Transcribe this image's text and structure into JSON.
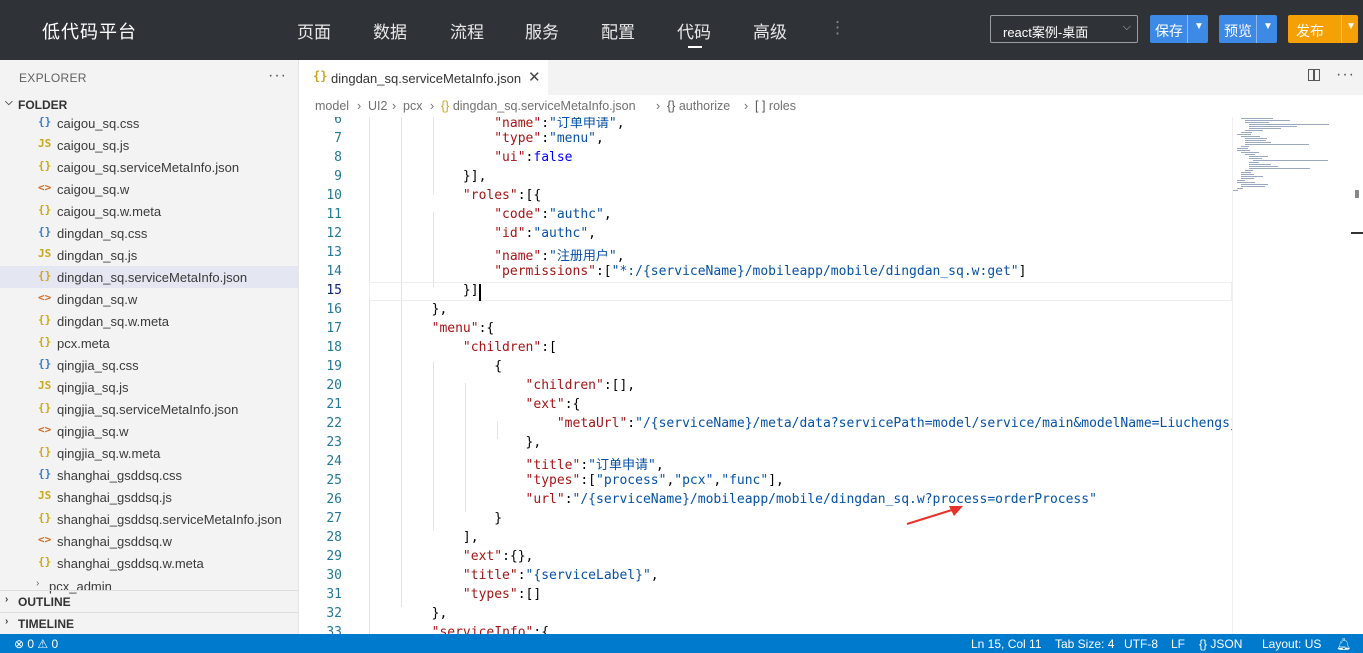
{
  "app": {
    "title": "低代码平台"
  },
  "nav": {
    "items": [
      "页面",
      "数据",
      "流程",
      "服务",
      "配置",
      "代码",
      "高级"
    ],
    "active": "代码"
  },
  "toolbar": {
    "project_select": "react案例-桌面",
    "save_label": "保存",
    "preview_label": "预览",
    "publish_label": "发布",
    "save_color": "#3d8ae6",
    "publish_color": "#f5a105"
  },
  "sidebar": {
    "explorer_title": "EXPLORER",
    "folder_title": "FOLDER",
    "files": [
      {
        "name": "caigou_sq.css",
        "type": "css",
        "icon": "{}"
      },
      {
        "name": "caigou_sq.js",
        "type": "js",
        "icon": "JS"
      },
      {
        "name": "caigou_sq.serviceMetaInfo.json",
        "type": "json",
        "icon": "{}"
      },
      {
        "name": "caigou_sq.w",
        "type": "w",
        "icon": "<>"
      },
      {
        "name": "caigou_sq.w.meta",
        "type": "json",
        "icon": "{}"
      },
      {
        "name": "dingdan_sq.css",
        "type": "css",
        "icon": "{}"
      },
      {
        "name": "dingdan_sq.js",
        "type": "js",
        "icon": "JS"
      },
      {
        "name": "dingdan_sq.serviceMetaInfo.json",
        "type": "json",
        "icon": "{}",
        "selected": true
      },
      {
        "name": "dingdan_sq.w",
        "type": "w",
        "icon": "<>"
      },
      {
        "name": "dingdan_sq.w.meta",
        "type": "json",
        "icon": "{}"
      },
      {
        "name": "pcx.meta",
        "type": "json",
        "icon": "{}"
      },
      {
        "name": "qingjia_sq.css",
        "type": "css",
        "icon": "{}"
      },
      {
        "name": "qingjia_sq.js",
        "type": "js",
        "icon": "JS"
      },
      {
        "name": "qingjia_sq.serviceMetaInfo.json",
        "type": "json",
        "icon": "{}"
      },
      {
        "name": "qingjia_sq.w",
        "type": "w",
        "icon": "<>"
      },
      {
        "name": "qingjia_sq.w.meta",
        "type": "json",
        "icon": "{}"
      },
      {
        "name": "shanghai_gsddsq.css",
        "type": "css",
        "icon": "{}"
      },
      {
        "name": "shanghai_gsddsq.js",
        "type": "js",
        "icon": "JS"
      },
      {
        "name": "shanghai_gsddsq.serviceMetaInfo.json",
        "type": "json",
        "icon": "{}"
      },
      {
        "name": "shanghai_gsddsq.w",
        "type": "w",
        "icon": "<>"
      },
      {
        "name": "shanghai_gsddsq.w.meta",
        "type": "json",
        "icon": "{}"
      }
    ],
    "subfolder": "pcx_admin",
    "outline_title": "OUTLINE",
    "timeline_title": "TIMELINE"
  },
  "editor": {
    "tab_label": "dingdan_sq.serviceMetaInfo.json",
    "breadcrumb": [
      "model",
      "UI2",
      "pcx",
      "dingdan_sq.serviceMetaInfo.json",
      "authorize",
      "roles"
    ],
    "current_line": 15,
    "lines": [
      {
        "n": 6,
        "text": "                \"name\":\"订单申请\","
      },
      {
        "n": 7,
        "text": "                \"type\":\"menu\","
      },
      {
        "n": 8,
        "text": "                \"ui\":false"
      },
      {
        "n": 9,
        "text": "            }],"
      },
      {
        "n": 10,
        "text": "            \"roles\":[{"
      },
      {
        "n": 11,
        "text": "                \"code\":\"authc\","
      },
      {
        "n": 12,
        "text": "                \"id\":\"authc\","
      },
      {
        "n": 13,
        "text": "                \"name\":\"注册用户\","
      },
      {
        "n": 14,
        "text": "                \"permissions\":[\"*:/{serviceName}/mobileapp/mobile/dingdan_sq.w:get\"]"
      },
      {
        "n": 15,
        "text": "            }]"
      },
      {
        "n": 16,
        "text": "        },"
      },
      {
        "n": 17,
        "text": "        \"menu\":{"
      },
      {
        "n": 18,
        "text": "            \"children\":["
      },
      {
        "n": 19,
        "text": "                {"
      },
      {
        "n": 20,
        "text": "                    \"children\":[],"
      },
      {
        "n": 21,
        "text": "                    \"ext\":{"
      },
      {
        "n": 22,
        "text": "                        \"metaUrl\":\"/{serviceName}/meta/data?servicePath=model/service/main&modelName=Liuchengsj\""
      },
      {
        "n": 23,
        "text": "                    },"
      },
      {
        "n": 24,
        "text": "                    \"title\":\"订单申请\","
      },
      {
        "n": 25,
        "text": "                    \"types\":[\"process\",\"pcx\",\"func\"],"
      },
      {
        "n": 26,
        "text": "                    \"url\":\"/{serviceName}/mobileapp/mobile/dingdan_sq.w?process=orderProcess\""
      },
      {
        "n": 27,
        "text": "                }"
      },
      {
        "n": 28,
        "text": "            ],"
      },
      {
        "n": 29,
        "text": "            \"ext\":{},"
      },
      {
        "n": 30,
        "text": "            \"title\":\"{serviceLabel}\","
      },
      {
        "n": 31,
        "text": "            \"types\":[]"
      },
      {
        "n": 32,
        "text": "        },"
      },
      {
        "n": 33,
        "text": "        \"serviceInfo\":{"
      }
    ]
  },
  "statusbar": {
    "problems": "⊗ 0 ⚠ 0",
    "position": "Ln 15, Col 11",
    "tab_size": "Tab Size: 4",
    "encoding": "UTF-8",
    "eol": "LF",
    "language": "{} JSON",
    "layout": "Layout: US"
  }
}
